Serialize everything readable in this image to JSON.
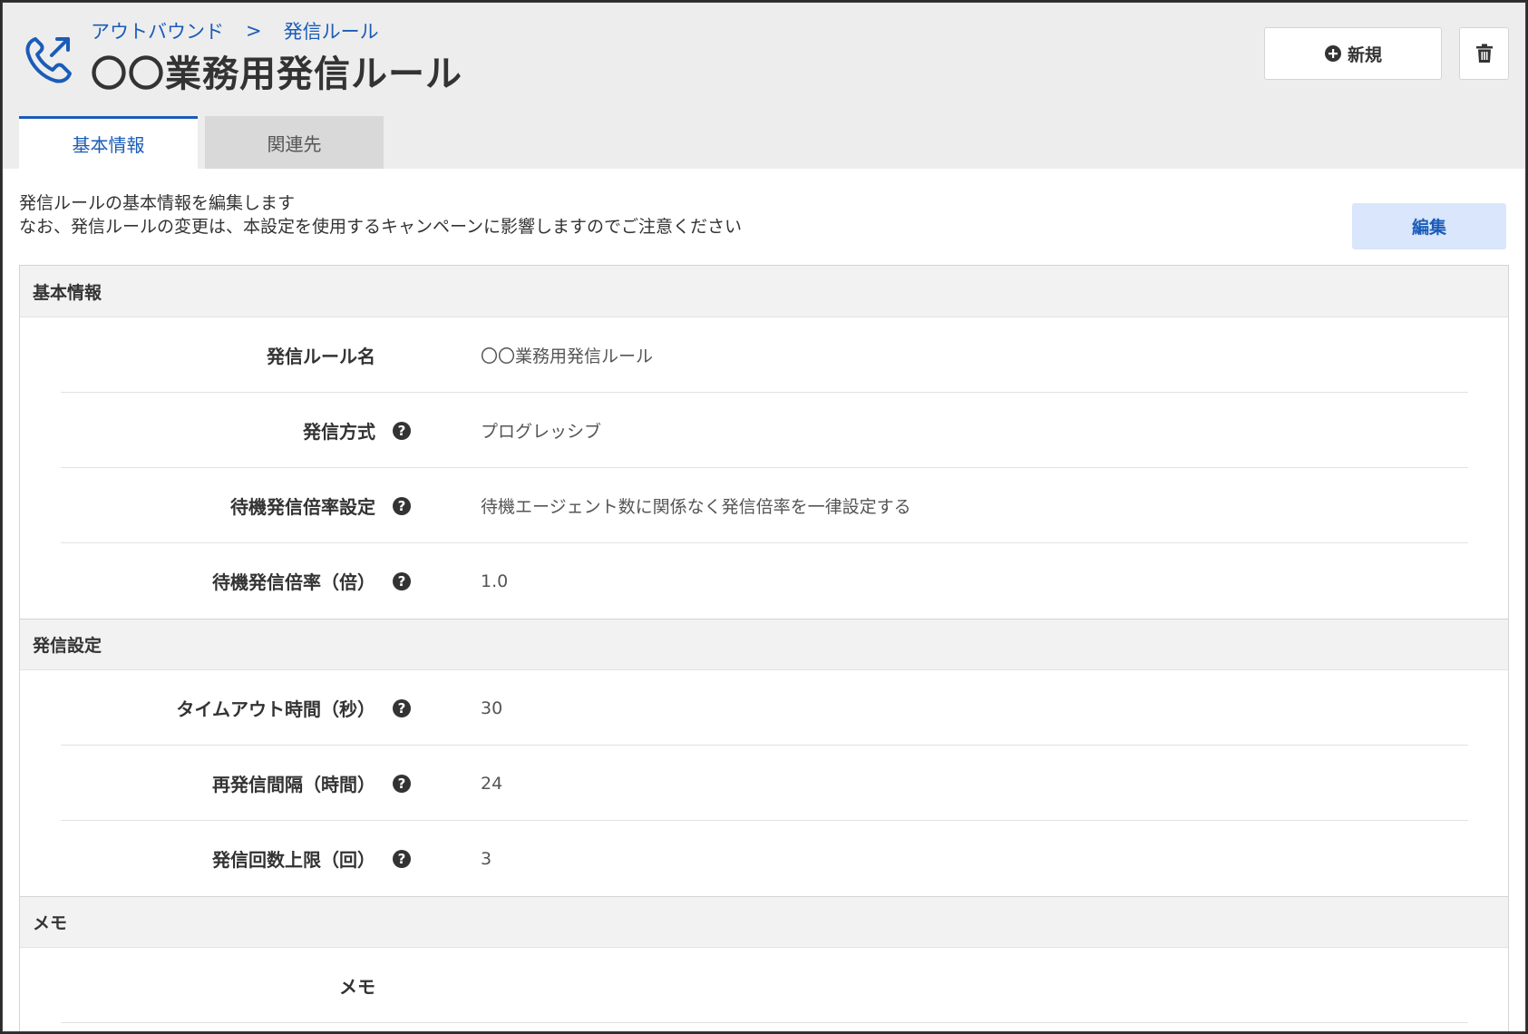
{
  "breadcrumb": {
    "parent": "アウトバウンド",
    "separator": ">",
    "current": "発信ルール"
  },
  "page_title": "〇〇業務用発信ルール",
  "actions": {
    "new_label": "新規"
  },
  "tabs": [
    {
      "label": "基本情報",
      "active": true
    },
    {
      "label": "関連先",
      "active": false
    }
  ],
  "description": {
    "line1": "発信ルールの基本情報を編集します",
    "line2": "なお、発信ルールの変更は、本設定を使用するキャンペーンに影響しますのでご注意ください"
  },
  "edit_label": "編集",
  "sections": {
    "basic": {
      "title": "基本情報",
      "rows": [
        {
          "label": "発信ルール名",
          "value": "〇〇業務用発信ルール"
        },
        {
          "label": "発信方式",
          "value": "プログレッシブ"
        },
        {
          "label": "待機発信倍率設定",
          "value": "待機エージェント数に関係なく発信倍率を一律設定する"
        },
        {
          "label": "待機発信倍率（倍）",
          "value": "1.0"
        }
      ]
    },
    "dial": {
      "title": "発信設定",
      "rows": [
        {
          "label": "タイムアウト時間（秒）",
          "value": "30"
        },
        {
          "label": "再発信間隔（時間）",
          "value": "24"
        },
        {
          "label": "発信回数上限（回）",
          "value": "3"
        }
      ]
    },
    "memo": {
      "title": "メモ",
      "rows": [
        {
          "label": "メモ",
          "value": ""
        }
      ]
    }
  },
  "colors": {
    "accent": "#1a5cb8",
    "header_bg": "#ededed",
    "edit_button_bg": "#d9e6fb"
  },
  "icons": {
    "logo": "outbound-phone-icon",
    "new": "plus-circle-icon",
    "delete": "trash-icon",
    "help": "question-circle-icon"
  }
}
